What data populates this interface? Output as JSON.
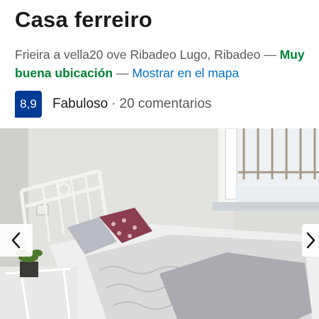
{
  "property": {
    "title": "Casa ferreiro",
    "address": "Frieira a vella20 ove Ribadeo Lugo, Ribadeo",
    "separator": "—",
    "location_badge": "Muy buena ubicación",
    "map_link": "Mostrar en el mapa"
  },
  "rating": {
    "score": "8,9",
    "label": "Fabuloso",
    "dot": "·",
    "reviews": "20 comentarios"
  },
  "gallery": {
    "prev_icon": "chevron-left-icon",
    "next_icon": "chevron-right-icon"
  },
  "colors": {
    "score_bg": "#003b95",
    "good": "#008234",
    "link": "#0071c2"
  }
}
